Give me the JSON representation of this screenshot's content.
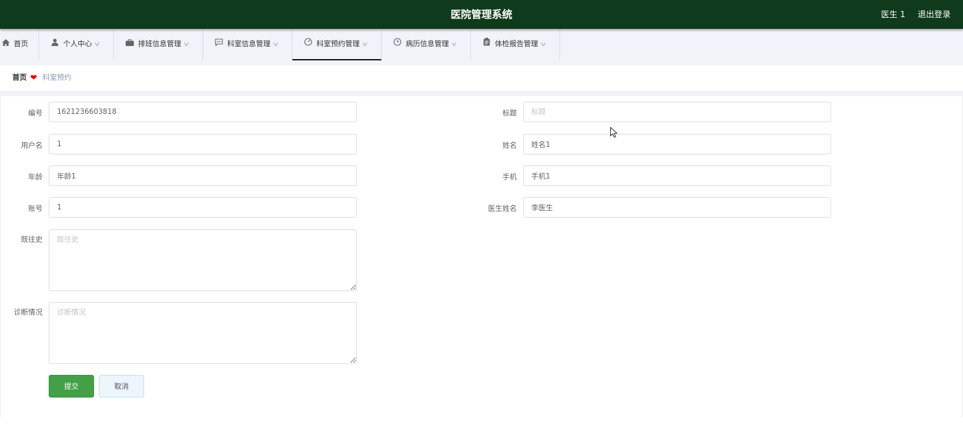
{
  "header": {
    "title": "医院管理系统",
    "user": "医生 1",
    "logout": "退出登录",
    "bg_color": "#0f3a1b"
  },
  "nav": {
    "items": [
      {
        "label": "首页",
        "icon": "home-icon"
      },
      {
        "label": "个人中心",
        "icon": "user-icon"
      },
      {
        "label": "排班信息管理",
        "icon": "briefcase-icon"
      },
      {
        "label": "科室信息管理",
        "icon": "chat-icon"
      },
      {
        "label": "科室预约管理",
        "icon": "gauge-icon",
        "active": true
      },
      {
        "label": "病历信息管理",
        "icon": "clock-icon"
      },
      {
        "label": "体检报告管理",
        "icon": "clipboard-icon"
      }
    ]
  },
  "breadcrumb": {
    "home": "首页",
    "current": "科室预约"
  },
  "form": {
    "bianhao": {
      "label": "编号",
      "value": "1621236603818",
      "placeholder": ""
    },
    "biaoti": {
      "label": "标题",
      "value": "",
      "placeholder": "标题"
    },
    "yonghuming": {
      "label": "用户名",
      "value": "1",
      "placeholder": ""
    },
    "xingming": {
      "label": "姓名",
      "value": "姓名1",
      "placeholder": ""
    },
    "nianling": {
      "label": "年龄",
      "value": "年龄1",
      "placeholder": ""
    },
    "shouji": {
      "label": "手机",
      "value": "手机1",
      "placeholder": ""
    },
    "zhanghao": {
      "label": "账号",
      "value": "1",
      "placeholder": ""
    },
    "yishengxingming": {
      "label": "医生姓名",
      "value": "李医生",
      "placeholder": ""
    },
    "jiwangshi": {
      "label": "既往史",
      "value": "",
      "placeholder": "既往史"
    },
    "zhenduan": {
      "label": "诊断情况",
      "value": "",
      "placeholder": "诊断情况"
    }
  },
  "buttons": {
    "submit": "提交",
    "cancel": "取消",
    "submit_color": "#43a047"
  }
}
